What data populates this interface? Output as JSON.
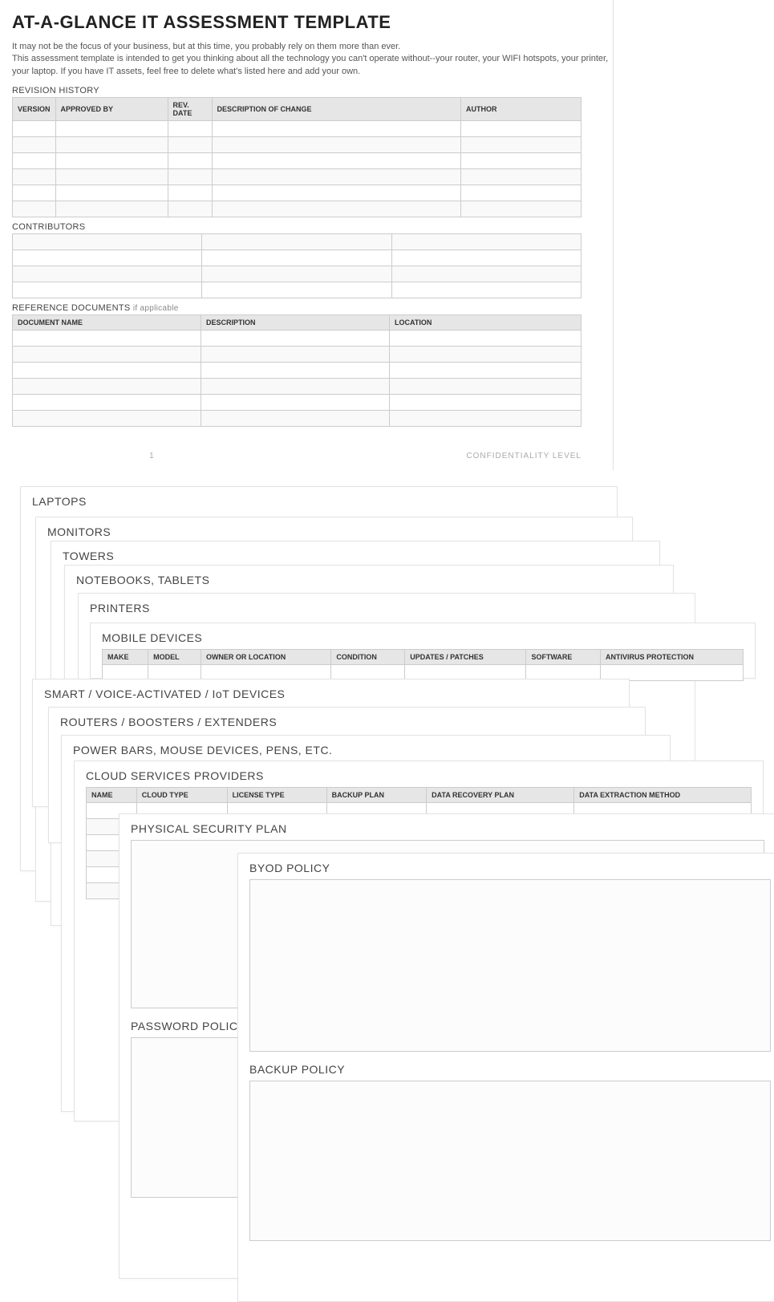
{
  "title": "AT-A-GLANCE IT ASSESSMENT TEMPLATE",
  "intro_line1": "It may not be the focus of your business, but at this time, you probably rely on them more than ever.",
  "intro_line2": "This assessment template is intended to get you thinking about all the technology you can't operate without--your router, your WIFI hotspots, your printer, your laptop. If you have IT assets, feel free to delete what's listed here and add your own.",
  "revision_history": {
    "label": "REVISION HISTORY",
    "headers": [
      "VERSION",
      "APPROVED BY",
      "REV. DATE",
      "DESCRIPTION OF CHANGE",
      "AUTHOR"
    ],
    "rows": 6
  },
  "contributors": {
    "label": "CONTRIBUTORS",
    "rows": 4,
    "cols": 3
  },
  "reference_docs": {
    "label": "REFERENCE DOCUMENTS",
    "sub": "if applicable",
    "headers": [
      "DOCUMENT NAME",
      "DESCRIPTION",
      "LOCATION"
    ],
    "rows": 6
  },
  "footer": {
    "page_number": "1",
    "confidentiality": "CONFIDENTIALITY LEVEL"
  },
  "cards": {
    "laptops": "LAPTOPS",
    "monitors": "MONITORS",
    "towers": "TOWERS",
    "notebooks": "NOTEBOOKS, TABLETS",
    "printers": "PRINTERS",
    "mobile": "MOBILE DEVICES",
    "mobile_headers": [
      "MAKE",
      "MODEL",
      "OWNER OR LOCATION",
      "CONDITION",
      "UPDATES / PATCHES",
      "SOFTWARE",
      "ANTIVIRUS PROTECTION"
    ],
    "smart": "SMART / VOICE-ACTIVATED / IoT DEVICES",
    "routers": "ROUTERS / BOOSTERS / EXTENDERS",
    "power": "POWER BARS, MOUSE DEVICES, PENS, ETC.",
    "cloud": "CLOUD SERVICES PROVIDERS",
    "cloud_headers": [
      "NAME",
      "CLOUD TYPE",
      "LICENSE TYPE",
      "BACKUP PLAN",
      "DATA RECOVERY PLAN",
      "DATA EXTRACTION METHOD"
    ],
    "physical": "PHYSICAL SECURITY PLAN",
    "byod": "BYOD POLICY",
    "password": "PASSWORD POLICY",
    "backup": "BACKUP POLICY"
  }
}
